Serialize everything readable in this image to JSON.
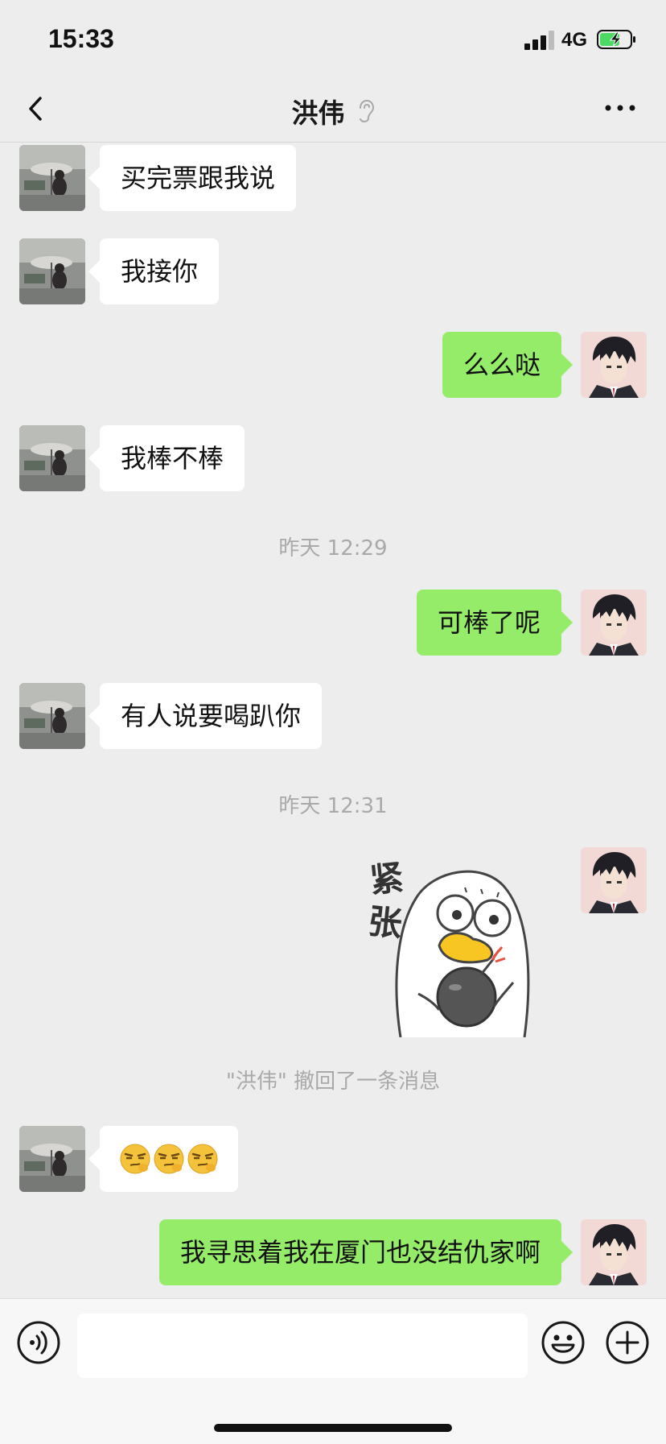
{
  "status_bar": {
    "time": "15:33",
    "network": "4G",
    "signal_bars": 3,
    "battery_charging": true
  },
  "nav": {
    "title": "洪伟",
    "title_icon": "earpiece-icon",
    "back_icon": "chevron-left-icon",
    "more_icon": "more-icon"
  },
  "messages": [
    {
      "type": "text",
      "side": "in",
      "text": "买完票跟我说"
    },
    {
      "type": "text",
      "side": "in",
      "text": "我接你"
    },
    {
      "type": "text",
      "side": "out",
      "text": "么么哒"
    },
    {
      "type": "text",
      "side": "in",
      "text": "我棒不棒"
    },
    {
      "type": "time",
      "text": "昨天 12:29"
    },
    {
      "type": "text",
      "side": "out",
      "text": "可棒了呢"
    },
    {
      "type": "text",
      "side": "in",
      "text": "有人说要喝趴你"
    },
    {
      "type": "time",
      "text": "昨天 12:31"
    },
    {
      "type": "sticker",
      "side": "out",
      "text": "紧张"
    },
    {
      "type": "system",
      "text": "\"洪伟\" 撤回了一条消息"
    },
    {
      "type": "emoji",
      "side": "in",
      "emoji": [
        "smirk-face",
        "smirk-face",
        "smirk-face"
      ]
    },
    {
      "type": "text",
      "side": "out",
      "text": "我寻思着我在厦门也没结仇家啊"
    }
  ],
  "input_bar": {
    "placeholder": "",
    "voice_icon": "voice-icon",
    "emoji_icon": "emoji-icon",
    "plus_icon": "plus-icon"
  },
  "colors": {
    "background": "#ededed",
    "outgoing_bubble": "#95ec69",
    "incoming_bubble": "#ffffff",
    "meta_text": "#a9a9a9"
  }
}
